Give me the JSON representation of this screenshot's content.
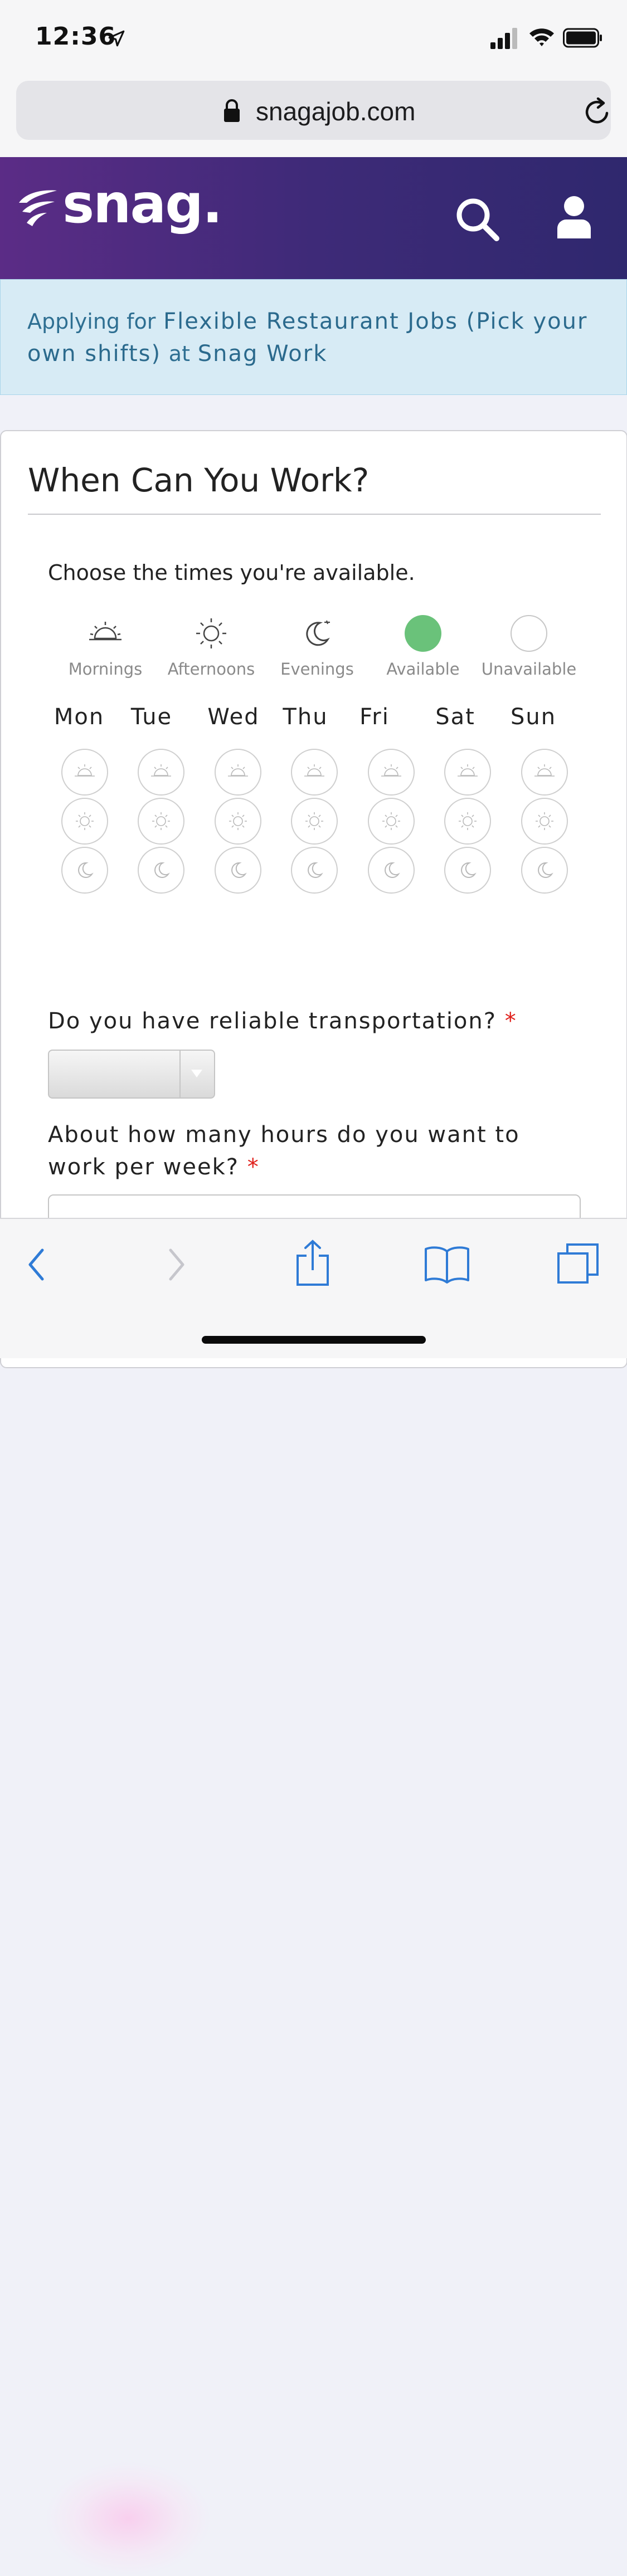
{
  "status_bar": {
    "time": "12:36"
  },
  "browser": {
    "url": "snagajob.com"
  },
  "site": {
    "logo": "snag."
  },
  "banner": {
    "prefix": "Applying for",
    "job": "Flexible Restaurant Jobs (Pick your own shifts)",
    "middle": "at",
    "company": "Snag Work"
  },
  "form": {
    "title": "When Can You Work?",
    "intro": "Choose the times you're available.",
    "legend": [
      {
        "label": "Mornings",
        "icon": "sunrise-icon"
      },
      {
        "label": "Afternoons",
        "icon": "sun-icon"
      },
      {
        "label": "Evenings",
        "icon": "moon-icon"
      },
      {
        "label": "Available",
        "icon": "green-dot"
      },
      {
        "label": "Unavailable",
        "icon": "white-dot"
      }
    ],
    "days": [
      "Mon",
      "Tue",
      "Wed",
      "Thu",
      "Fri",
      "Sat",
      "Sun"
    ],
    "availability": {
      "Mon": [
        "unavailable",
        "unavailable",
        "unavailable"
      ],
      "Tue": [
        "unavailable",
        "unavailable",
        "unavailable"
      ],
      "Wed": [
        "unavailable",
        "unavailable",
        "unavailable"
      ],
      "Thu": [
        "unavailable",
        "unavailable",
        "unavailable"
      ],
      "Fri": [
        "unavailable",
        "unavailable",
        "unavailable"
      ],
      "Sat": [
        "unavailable",
        "unavailable",
        "unavailable"
      ],
      "Sun": [
        "unavailable",
        "unavailable",
        "unavailable"
      ]
    },
    "transport_question": "Do you have reliable transportation?",
    "transport_value": "",
    "hours_question": "About how many hours do you want to work per week?",
    "hours_value": "",
    "required_mark": "*"
  },
  "colors": {
    "header_start": "#5b2c86",
    "header_end": "#2f286e",
    "banner_bg": "#d7ebf5",
    "banner_text": "#2e6f92",
    "available": "#6ac27a",
    "required": "#e0201b",
    "ios_blue": "#2f7bd6"
  },
  "toolbar": {
    "icons": [
      "back-icon",
      "forward-icon",
      "share-icon",
      "bookmarks-icon",
      "tabs-icon"
    ]
  }
}
